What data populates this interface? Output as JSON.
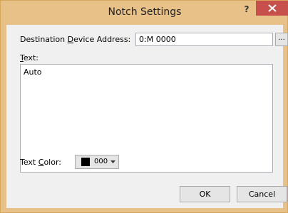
{
  "window": {
    "title": "Notch Settings",
    "help_label": "?",
    "close_icon": "close-icon"
  },
  "form": {
    "address_label_pre": "Destination ",
    "address_label_key": "D",
    "address_label_post": "evice Address:",
    "address_value": "0:M 0000",
    "browse_label": "...",
    "text_label_key": "T",
    "text_label_post": "ext:",
    "text_value": "Auto",
    "color_label_pre": "Text ",
    "color_label_key": "C",
    "color_label_post": "olor:",
    "color_value": "000",
    "color_swatch": "#000000"
  },
  "buttons": {
    "ok_label": "OK",
    "cancel_label": "Cancel"
  }
}
